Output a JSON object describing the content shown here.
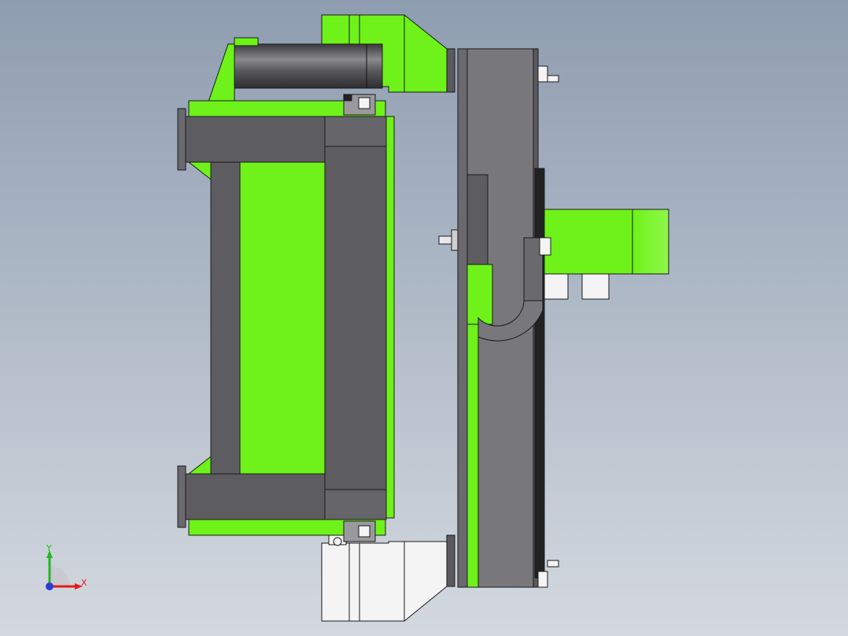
{
  "viewport": {
    "background_top": "#8e9db0",
    "background_bottom": "#d4d9e0"
  },
  "colors": {
    "green": "#6ef21a",
    "green_light": "#86f53a",
    "gray_dark": "#5d5d61",
    "gray_mid": "#78787c",
    "gray_light": "#9a9a9e",
    "white_part": "#f4f4f4",
    "edge": "#1a1a1a",
    "triad_x": "#e11d1d",
    "triad_y": "#1fb81f",
    "triad_z": "#2a3fd6"
  },
  "triad": {
    "x_label": "X",
    "y_label": "Y"
  }
}
